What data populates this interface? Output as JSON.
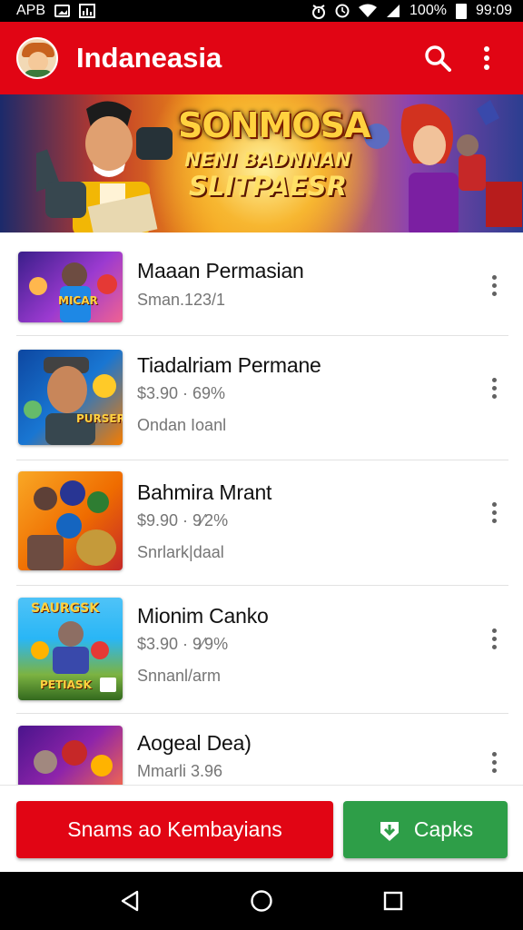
{
  "status_bar": {
    "left_text": "APB",
    "battery": "100%",
    "time": "99:09"
  },
  "app_bar": {
    "title": "Indaneasia",
    "search_icon": "search-icon",
    "menu_icon": "more-vert-icon",
    "color": "#e10514"
  },
  "banner": {
    "title": "SONMOSA",
    "line1": "NENI BADNNAN",
    "line2": "SLITPAESR"
  },
  "list": {
    "items": [
      {
        "title": "Maaan Permasian",
        "line1": "Sman.123/1",
        "line2": ""
      },
      {
        "title": "Tiadalriam Permane",
        "line1": "$3.90 · 69%",
        "line2": "Ondan Ioanl"
      },
      {
        "title": "Bahmira Mrant",
        "line1": "$9.90 · 9⁄2%",
        "line2": "Snrlark|daal"
      },
      {
        "title": "Mionim Canko",
        "line1": "$3.90 · 9⁄9%",
        "line2": "Snnanl/arm"
      },
      {
        "title": "Aogeal Dea)",
        "line1": "Mmarli 3.96",
        "line2": ""
      }
    ],
    "thumb_texts": {
      "t1": "MICAR",
      "t2": "PURSER",
      "t4a": "SAURGSK",
      "t4b": "PETIASK"
    }
  },
  "bottom": {
    "primary_label": "Snams ao Kembayians",
    "secondary_label": "Capks",
    "primary_color": "#e10514",
    "secondary_color": "#2e9e48"
  },
  "nav": {
    "back_icon": "back-icon",
    "home_icon": "home-icon",
    "recents_icon": "recents-icon"
  }
}
